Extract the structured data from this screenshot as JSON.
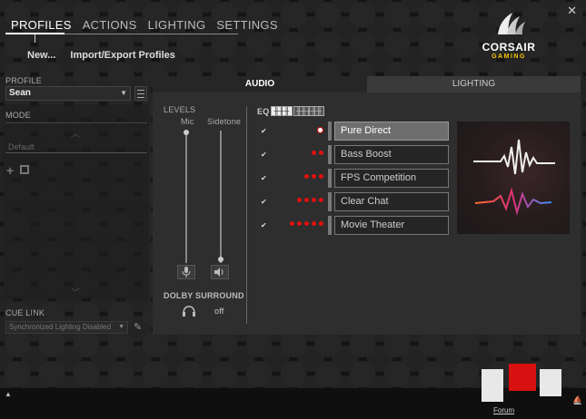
{
  "nav": {
    "tabs": [
      "PROFILES",
      "ACTIONS",
      "LIGHTING",
      "SETTINGS"
    ],
    "active": "PROFILES"
  },
  "logo": {
    "brand": "CORSAIR",
    "sub": "GAMING"
  },
  "actions": {
    "new_label": "New...",
    "import_export_label": "Import/Export Profiles"
  },
  "profile": {
    "label": "PROFILE",
    "selected": "Sean"
  },
  "mode": {
    "label": "MODE",
    "default_label": "Default"
  },
  "cue_link": {
    "label": "CUE LINK",
    "selected": "Synchronized Lighting Disabled"
  },
  "panel_tabs": {
    "audio": "AUDIO",
    "lighting": "LIGHTING"
  },
  "levels": {
    "label": "LEVELS",
    "mic_label": "Mic",
    "sidetone_label": "Sidetone",
    "mic_level": 1.0,
    "sidetone_level": 0.0
  },
  "dolby": {
    "label": "DOLBY SURROUND",
    "state": "off"
  },
  "eq": {
    "label": "EQ",
    "presets": [
      {
        "name": "Pure Direct",
        "checked": true,
        "dots": 1,
        "selected": true
      },
      {
        "name": "Bass Boost",
        "checked": true,
        "dots": 2,
        "selected": false
      },
      {
        "name": "FPS Competition",
        "checked": true,
        "dots": 3,
        "selected": false
      },
      {
        "name": "Clear Chat",
        "checked": true,
        "dots": 4,
        "selected": false
      },
      {
        "name": "Movie Theater",
        "checked": true,
        "dots": 5,
        "selected": false
      }
    ]
  },
  "footer": {
    "forum_label": "Forum"
  },
  "colors": {
    "accent_red": "#e01010",
    "logo_yellow": "#f5c400"
  },
  "icons": [
    "close-icon",
    "corsair-sails-icon",
    "menu-icon",
    "plus-icon",
    "copy-icon",
    "pencil-icon",
    "mic-icon",
    "speaker-icon",
    "headphones-icon",
    "eq-sliders-icon",
    "sound-wave-icon"
  ]
}
